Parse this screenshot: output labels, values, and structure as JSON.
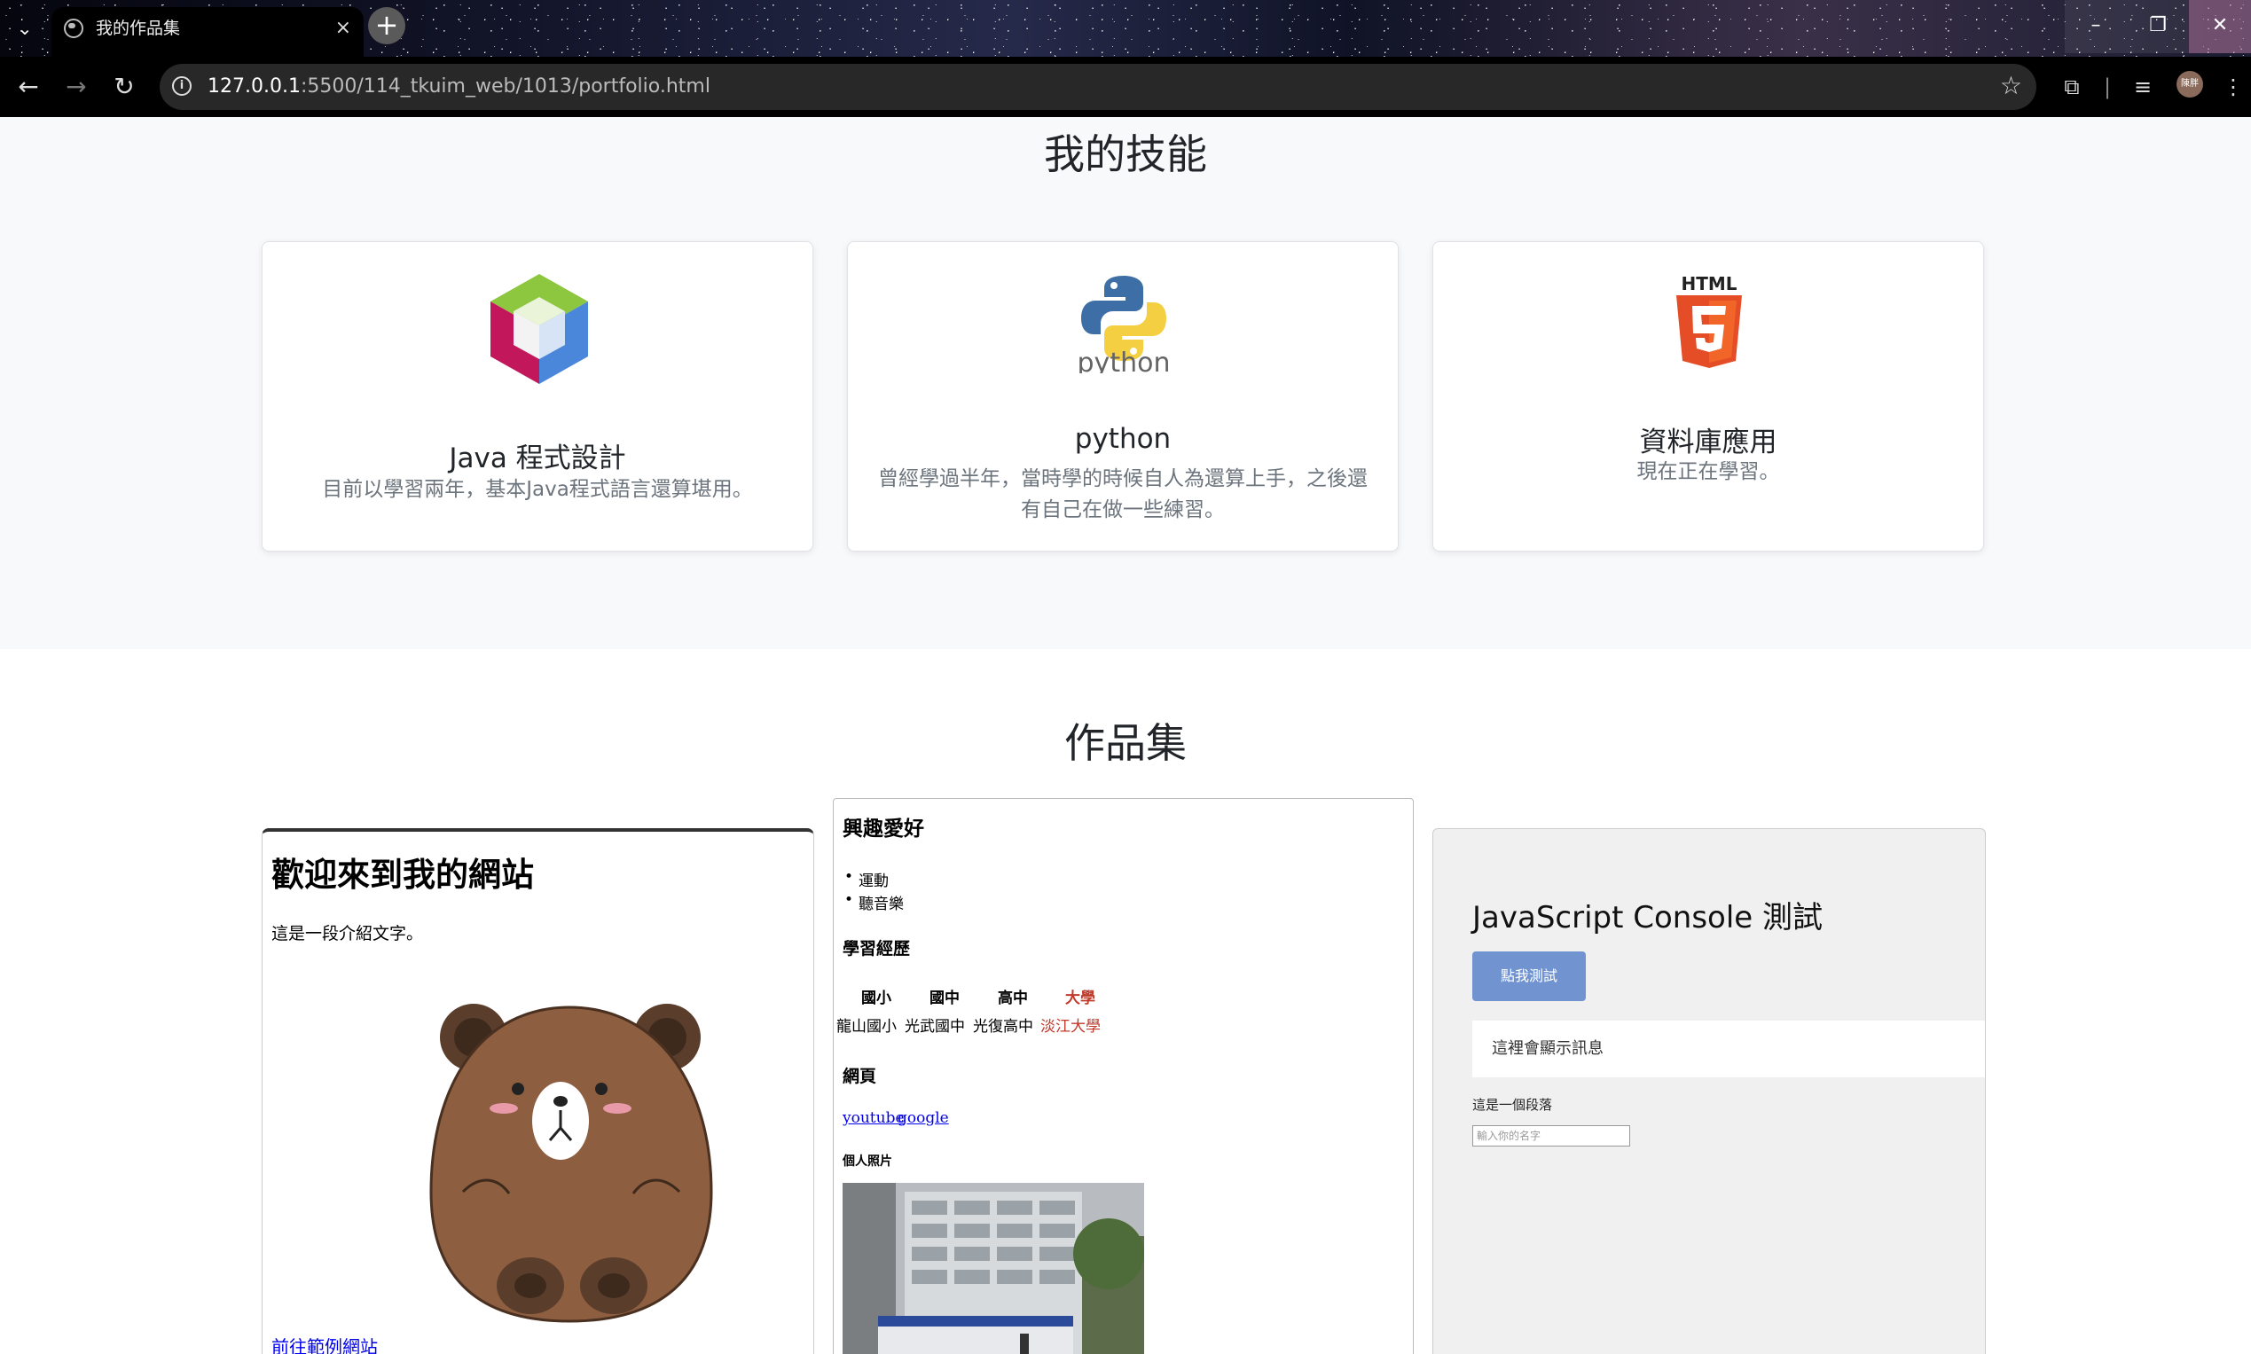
{
  "browser": {
    "tab_title": "我的作品集",
    "url_host": "127.0.0.1",
    "url_rest": ":5500/114_tkuim_web/1013/portfolio.html",
    "avatar_label": "陳胖"
  },
  "skills": {
    "heading": "我的技能",
    "cards": [
      {
        "title": "Java 程式設計",
        "text": "目前以學習兩年，基本Java程式語言還算堪用。",
        "icon": "netbeans-cube-icon"
      },
      {
        "title": "python",
        "text": "曾經學過半年，當時學的時候自人為還算上手，之後還有自己在做一些練習。",
        "icon": "python-logo-icon",
        "logo_text": "python"
      },
      {
        "title": "資料庫應用",
        "text": "現在正在學習。",
        "icon": "html5-shield-icon",
        "logo_text": "HTML"
      }
    ]
  },
  "portfolio": {
    "heading": "作品集",
    "frame1": {
      "heading": "歡迎來到我的網站",
      "intro": "這是一段介紹文字。",
      "link": "前往範例網站"
    },
    "frame2": {
      "hobbies_heading": "興趣愛好",
      "hobbies": [
        "運動",
        "聽音樂"
      ],
      "edu_heading": "學習經歷",
      "edu_headers": [
        "國小",
        "國中",
        "高中",
        "大學"
      ],
      "edu_values": [
        "龍山國小",
        "光武國中",
        "光復高中",
        "淡江大學"
      ],
      "web_heading": "網頁",
      "links": [
        "youtube",
        "google"
      ],
      "photo_heading": "個人照片"
    },
    "frame3": {
      "heading": "JavaScript Console 測試",
      "button": "點我測試",
      "message": "這裡會顯示訊息",
      "paragraph": "這是一個段落",
      "input_placeholder": "輸入你的名字"
    }
  },
  "colors": {
    "accent_red": "#c0392b",
    "button_blue": "#7194d0"
  }
}
